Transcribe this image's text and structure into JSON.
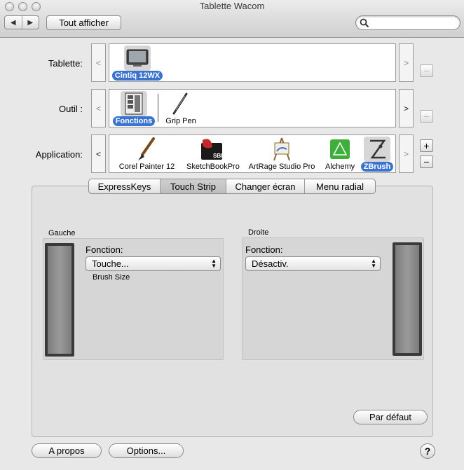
{
  "window": {
    "title": "Tablette Wacom"
  },
  "toolbar": {
    "back_glyph": "◀",
    "forward_glyph": "▶",
    "show_all_label": "Tout afficher",
    "search_placeholder": ""
  },
  "rows": {
    "tablet": {
      "label": "Tablette:",
      "prev": "<",
      "next": ">",
      "items": [
        {
          "name": "Cintiq 12WX",
          "icon": "tablet-icon",
          "selected": true
        }
      ]
    },
    "tool": {
      "label": "Outil :",
      "prev": "<",
      "next": ">",
      "items": [
        {
          "name": "Fonctions",
          "icon": "functions-icon",
          "selected": true
        },
        {
          "name": "Grip Pen",
          "icon": "pen-icon",
          "selected": false
        }
      ]
    },
    "application": {
      "label": "Application:",
      "prev": "<",
      "next": ">",
      "items": [
        {
          "name": "Corel Painter 12",
          "icon": "brush-icon",
          "selected": false
        },
        {
          "name": "SketchBookPro",
          "icon": "sketchbook-icon",
          "selected": false
        },
        {
          "name": "ArtRage Studio Pro",
          "icon": "easel-icon",
          "selected": false
        },
        {
          "name": "Alchemy",
          "icon": "alchemy-icon",
          "selected": false
        },
        {
          "name": "ZBrush",
          "icon": "zbrush-icon",
          "selected": true
        }
      ]
    }
  },
  "side_buttons": {
    "minus": "−",
    "plus": "+"
  },
  "tabs": [
    {
      "label": "ExpressKeys",
      "active": false
    },
    {
      "label": "Touch Strip",
      "active": true
    },
    {
      "label": "Changer écran",
      "active": false
    },
    {
      "label": "Menu radial",
      "active": false
    }
  ],
  "left": {
    "title": "Gauche",
    "function_label": "Fonction:",
    "value": "Touche...",
    "detail": "Brush Size"
  },
  "right": {
    "title": "Droite",
    "function_label": "Fonction:",
    "value": "Désactiv."
  },
  "buttons": {
    "default": "Par défaut",
    "about": "A propos",
    "options": "Options...",
    "help": "?"
  },
  "icons": {
    "sbp_badge": "SBP"
  },
  "colors": {
    "selection": "#3b73d1"
  }
}
